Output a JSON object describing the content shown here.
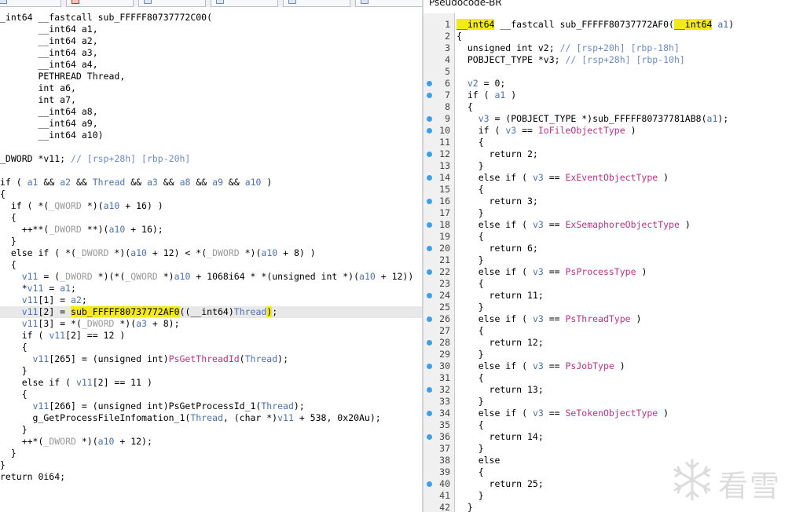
{
  "tabs": [
    {
      "label": "Ps",
      "icon": "document-icon"
    },
    {
      "label": "Ps",
      "icon": "red-document-icon"
    },
    {
      "label": "Ps",
      "icon": "document-icon"
    },
    {
      "label": "Ps",
      "icon": "document-icon"
    },
    {
      "label": "Ps",
      "icon": "document-icon"
    },
    {
      "label": "Ps",
      "icon": "document-icon"
    }
  ],
  "left_code": [
    [
      {
        "t": "_int64 __fastcall sub_FFFFF80737772C00("
      }
    ],
    [
      {
        "t": "       __int64 a1,"
      }
    ],
    [
      {
        "t": "       __int64 a2,"
      }
    ],
    [
      {
        "t": "       __int64 a3,"
      }
    ],
    [
      {
        "t": "       __int64 a4,"
      }
    ],
    [
      {
        "t": "       PETHREAD Thread,"
      }
    ],
    [
      {
        "t": "       int a6,"
      }
    ],
    [
      {
        "t": "       int a7,"
      }
    ],
    [
      {
        "t": "       __int64 a8,"
      }
    ],
    [
      {
        "t": "       __int64 a9,"
      }
    ],
    [
      {
        "t": "       __int64 a10)"
      }
    ],
    [
      {
        "t": ""
      }
    ],
    [
      {
        "t": "_DWORD *v11; "
      },
      {
        "t": "// [rsp+28h] [rbp-20h]",
        "c": "cmt"
      }
    ],
    [
      {
        "t": ""
      }
    ],
    [
      {
        "t": "if ( "
      },
      {
        "t": "a1",
        "c": "var"
      },
      {
        "t": " && "
      },
      {
        "t": "a2",
        "c": "var"
      },
      {
        "t": " && "
      },
      {
        "t": "Thread",
        "c": "var"
      },
      {
        "t": " && "
      },
      {
        "t": "a3",
        "c": "var"
      },
      {
        "t": " && "
      },
      {
        "t": "a8",
        "c": "var"
      },
      {
        "t": " && "
      },
      {
        "t": "a9",
        "c": "var"
      },
      {
        "t": " && "
      },
      {
        "t": "a10",
        "c": "var"
      },
      {
        "t": " )"
      }
    ],
    [
      {
        "t": "{"
      }
    ],
    [
      {
        "t": "  if ( *("
      },
      {
        "t": "_QWORD",
        "c": "gray"
      },
      {
        "t": " *)("
      },
      {
        "t": "a10",
        "c": "var"
      },
      {
        "t": " + 16) )"
      }
    ],
    [
      {
        "t": "  {"
      }
    ],
    [
      {
        "t": "    ++**("
      },
      {
        "t": "_DWORD",
        "c": "gray"
      },
      {
        "t": " **)("
      },
      {
        "t": "a10",
        "c": "var"
      },
      {
        "t": " + 16);"
      }
    ],
    [
      {
        "t": "  }"
      }
    ],
    [
      {
        "t": "  else if ( *("
      },
      {
        "t": "_DWORD",
        "c": "gray"
      },
      {
        "t": " *)("
      },
      {
        "t": "a10",
        "c": "var"
      },
      {
        "t": " + 12) < *("
      },
      {
        "t": "_DWORD",
        "c": "gray"
      },
      {
        "t": " *)("
      },
      {
        "t": "a10",
        "c": "var"
      },
      {
        "t": " + 8) )"
      }
    ],
    [
      {
        "t": "  {"
      }
    ],
    [
      {
        "t": "    "
      },
      {
        "t": "v11",
        "c": "var"
      },
      {
        "t": " = ("
      },
      {
        "t": "_DWORD",
        "c": "gray"
      },
      {
        "t": " *)(*("
      },
      {
        "t": "_QWORD",
        "c": "gray"
      },
      {
        "t": " *)"
      },
      {
        "t": "a10",
        "c": "var"
      },
      {
        "t": " + 1068i64 * *(unsigned int *)("
      },
      {
        "t": "a10",
        "c": "var"
      },
      {
        "t": " + 12))"
      }
    ],
    [
      {
        "t": "    *"
      },
      {
        "t": "v11",
        "c": "var"
      },
      {
        "t": " = "
      },
      {
        "t": "a1",
        "c": "var"
      },
      {
        "t": ";"
      }
    ],
    [
      {
        "t": "    "
      },
      {
        "t": "v11",
        "c": "var"
      },
      {
        "t": "[1] = "
      },
      {
        "t": "a2",
        "c": "var"
      },
      {
        "t": ";"
      }
    ],
    [
      {
        "t": "    "
      },
      {
        "t": "v11",
        "c": "var"
      },
      {
        "t": "[2] = "
      },
      {
        "t": "sub_FFFFF80737772AF0",
        "c": "yel"
      },
      {
        "t": "((__int64)"
      },
      {
        "t": "Thread",
        "c": "var"
      },
      {
        "t": ")",
        "c": "yel"
      },
      {
        "t": ";"
      }
    ],
    [
      {
        "t": "    "
      },
      {
        "t": "v11",
        "c": "var"
      },
      {
        "t": "[3] = *("
      },
      {
        "t": "_DWORD",
        "c": "gray"
      },
      {
        "t": " *)("
      },
      {
        "t": "a3",
        "c": "var"
      },
      {
        "t": " + 8);"
      }
    ],
    [
      {
        "t": "    if ( "
      },
      {
        "t": "v11",
        "c": "var"
      },
      {
        "t": "[2] == 12 )"
      }
    ],
    [
      {
        "t": "    {"
      }
    ],
    [
      {
        "t": "      "
      },
      {
        "t": "v11",
        "c": "var"
      },
      {
        "t": "[265] = (unsigned int)"
      },
      {
        "t": "PsGetThreadId",
        "c": "fnp"
      },
      {
        "t": "("
      },
      {
        "t": "Thread",
        "c": "var"
      },
      {
        "t": ");"
      }
    ],
    [
      {
        "t": "    }"
      }
    ],
    [
      {
        "t": "    else if ( "
      },
      {
        "t": "v11",
        "c": "var"
      },
      {
        "t": "[2] == 11 )"
      }
    ],
    [
      {
        "t": "    {"
      }
    ],
    [
      {
        "t": "      "
      },
      {
        "t": "v11",
        "c": "var"
      },
      {
        "t": "[266] = (unsigned int)PsGetProcessId_1("
      },
      {
        "t": "Thread",
        "c": "var"
      },
      {
        "t": ");"
      }
    ],
    [
      {
        "t": "      g_GetProcessFileInfomation_1("
      },
      {
        "t": "Thread",
        "c": "var"
      },
      {
        "t": ", (char *)"
      },
      {
        "t": "v11",
        "c": "var"
      },
      {
        "t": " + 538, 0x20Au);"
      }
    ],
    [
      {
        "t": "    }"
      }
    ],
    [
      {
        "t": "    ++*("
      },
      {
        "t": "_DWORD",
        "c": "gray"
      },
      {
        "t": " *)("
      },
      {
        "t": "a10",
        "c": "var"
      },
      {
        "t": " + 12);"
      }
    ],
    [
      {
        "t": "  }"
      }
    ],
    [
      {
        "t": "}"
      }
    ],
    [
      {
        "t": "return 0i64;"
      }
    ]
  ],
  "right": {
    "title": "Pseudocode-BR",
    "lines": [
      {
        "n": "1",
        "dot": false,
        "seg": [
          {
            "t": "__int64",
            "c": "yel"
          },
          {
            "t": " __fastcall sub_FFFFF80737772AF0("
          },
          {
            "t": "__int64",
            "c": "yel"
          },
          {
            "t": " "
          },
          {
            "t": "a1",
            "c": "var"
          },
          {
            "t": ")"
          }
        ]
      },
      {
        "n": "2",
        "dot": false,
        "seg": [
          {
            "t": "{"
          }
        ]
      },
      {
        "n": "3",
        "dot": false,
        "seg": [
          {
            "t": "  unsigned int v2; "
          },
          {
            "t": "// [rsp+20h] [rbp-18h]",
            "c": "cmt"
          }
        ]
      },
      {
        "n": "4",
        "dot": false,
        "seg": [
          {
            "t": "  POBJECT_TYPE *v3; "
          },
          {
            "t": "// [rsp+28h] [rbp-10h]",
            "c": "cmt"
          }
        ]
      },
      {
        "n": "5",
        "dot": false,
        "seg": [
          {
            "t": ""
          }
        ]
      },
      {
        "n": "6",
        "dot": true,
        "seg": [
          {
            "t": "  "
          },
          {
            "t": "v2",
            "c": "var"
          },
          {
            "t": " = 0;"
          }
        ]
      },
      {
        "n": "7",
        "dot": true,
        "seg": [
          {
            "t": "  if ( "
          },
          {
            "t": "a1",
            "c": "var"
          },
          {
            "t": " )"
          }
        ]
      },
      {
        "n": "8",
        "dot": false,
        "seg": [
          {
            "t": "  {"
          }
        ]
      },
      {
        "n": "9",
        "dot": true,
        "seg": [
          {
            "t": "    "
          },
          {
            "t": "v3",
            "c": "var"
          },
          {
            "t": " = (POBJECT_TYPE *)sub_FFFFF80737781AB8("
          },
          {
            "t": "a1",
            "c": "var"
          },
          {
            "t": ");"
          }
        ]
      },
      {
        "n": "10",
        "dot": true,
        "seg": [
          {
            "t": "    if ( "
          },
          {
            "t": "v3",
            "c": "var"
          },
          {
            "t": " == "
          },
          {
            "t": "IoFileObjectType",
            "c": "fnp"
          },
          {
            "t": " )"
          }
        ]
      },
      {
        "n": "11",
        "dot": false,
        "seg": [
          {
            "t": "    {"
          }
        ]
      },
      {
        "n": "12",
        "dot": true,
        "seg": [
          {
            "t": "      return 2;"
          }
        ]
      },
      {
        "n": "13",
        "dot": false,
        "seg": [
          {
            "t": "    }"
          }
        ]
      },
      {
        "n": "14",
        "dot": true,
        "seg": [
          {
            "t": "    else if ( "
          },
          {
            "t": "v3",
            "c": "var"
          },
          {
            "t": " == "
          },
          {
            "t": "ExEventObjectType",
            "c": "fnp"
          },
          {
            "t": " )"
          }
        ]
      },
      {
        "n": "15",
        "dot": false,
        "seg": [
          {
            "t": "    {"
          }
        ]
      },
      {
        "n": "16",
        "dot": true,
        "seg": [
          {
            "t": "      return 3;"
          }
        ]
      },
      {
        "n": "17",
        "dot": false,
        "seg": [
          {
            "t": "    }"
          }
        ]
      },
      {
        "n": "18",
        "dot": true,
        "seg": [
          {
            "t": "    else if ( "
          },
          {
            "t": "v3",
            "c": "var"
          },
          {
            "t": " == "
          },
          {
            "t": "ExSemaphoreObjectType",
            "c": "fnp"
          },
          {
            "t": " )"
          }
        ]
      },
      {
        "n": "19",
        "dot": false,
        "seg": [
          {
            "t": "    {"
          }
        ]
      },
      {
        "n": "20",
        "dot": true,
        "seg": [
          {
            "t": "      return 6;"
          }
        ]
      },
      {
        "n": "21",
        "dot": false,
        "seg": [
          {
            "t": "    }"
          }
        ]
      },
      {
        "n": "22",
        "dot": true,
        "seg": [
          {
            "t": "    else if ( "
          },
          {
            "t": "v3",
            "c": "var"
          },
          {
            "t": " == "
          },
          {
            "t": "PsProcessType",
            "c": "fnp"
          },
          {
            "t": " )"
          }
        ]
      },
      {
        "n": "23",
        "dot": false,
        "seg": [
          {
            "t": "    {"
          }
        ]
      },
      {
        "n": "24",
        "dot": true,
        "seg": [
          {
            "t": "      return 11;"
          }
        ]
      },
      {
        "n": "25",
        "dot": false,
        "seg": [
          {
            "t": "    }"
          }
        ]
      },
      {
        "n": "26",
        "dot": true,
        "seg": [
          {
            "t": "    else if ( "
          },
          {
            "t": "v3",
            "c": "var"
          },
          {
            "t": " == "
          },
          {
            "t": "PsThreadType",
            "c": "fnp"
          },
          {
            "t": " )"
          }
        ]
      },
      {
        "n": "27",
        "dot": false,
        "seg": [
          {
            "t": "    {"
          }
        ]
      },
      {
        "n": "28",
        "dot": true,
        "seg": [
          {
            "t": "      return 12;"
          }
        ]
      },
      {
        "n": "29",
        "dot": false,
        "seg": [
          {
            "t": "    }"
          }
        ]
      },
      {
        "n": "30",
        "dot": true,
        "seg": [
          {
            "t": "    else if ( "
          },
          {
            "t": "v3",
            "c": "var"
          },
          {
            "t": " == "
          },
          {
            "t": "PsJobType",
            "c": "fnp"
          },
          {
            "t": " )"
          }
        ]
      },
      {
        "n": "31",
        "dot": false,
        "seg": [
          {
            "t": "    {"
          }
        ]
      },
      {
        "n": "32",
        "dot": true,
        "seg": [
          {
            "t": "      return 13;"
          }
        ]
      },
      {
        "n": "33",
        "dot": false,
        "seg": [
          {
            "t": "    }"
          }
        ]
      },
      {
        "n": "34",
        "dot": true,
        "seg": [
          {
            "t": "    else if ( "
          },
          {
            "t": "v3",
            "c": "var"
          },
          {
            "t": " == "
          },
          {
            "t": "SeTokenObjectType",
            "c": "fnp"
          },
          {
            "t": " )"
          }
        ]
      },
      {
        "n": "35",
        "dot": false,
        "seg": [
          {
            "t": "    {"
          }
        ]
      },
      {
        "n": "36",
        "dot": true,
        "seg": [
          {
            "t": "      return 14;"
          }
        ]
      },
      {
        "n": "37",
        "dot": false,
        "seg": [
          {
            "t": "    }"
          }
        ]
      },
      {
        "n": "38",
        "dot": false,
        "seg": [
          {
            "t": "    else"
          }
        ]
      },
      {
        "n": "39",
        "dot": false,
        "seg": [
          {
            "t": "    {"
          }
        ]
      },
      {
        "n": "40",
        "dot": true,
        "seg": [
          {
            "t": "      return 25;"
          }
        ]
      },
      {
        "n": "41",
        "dot": false,
        "seg": [
          {
            "t": "    }"
          }
        ]
      },
      {
        "n": "42",
        "dot": false,
        "seg": [
          {
            "t": "  }"
          }
        ]
      }
    ]
  },
  "watermark": {
    "text": "看雪",
    "icon": "snowflake-logo-icon"
  },
  "colors": {
    "highlight": "#f4ea1a",
    "variable": "#4a72b0",
    "import": "#c0308a",
    "comment": "#6a8cc7",
    "breakpoint": "#3aa0e8"
  }
}
